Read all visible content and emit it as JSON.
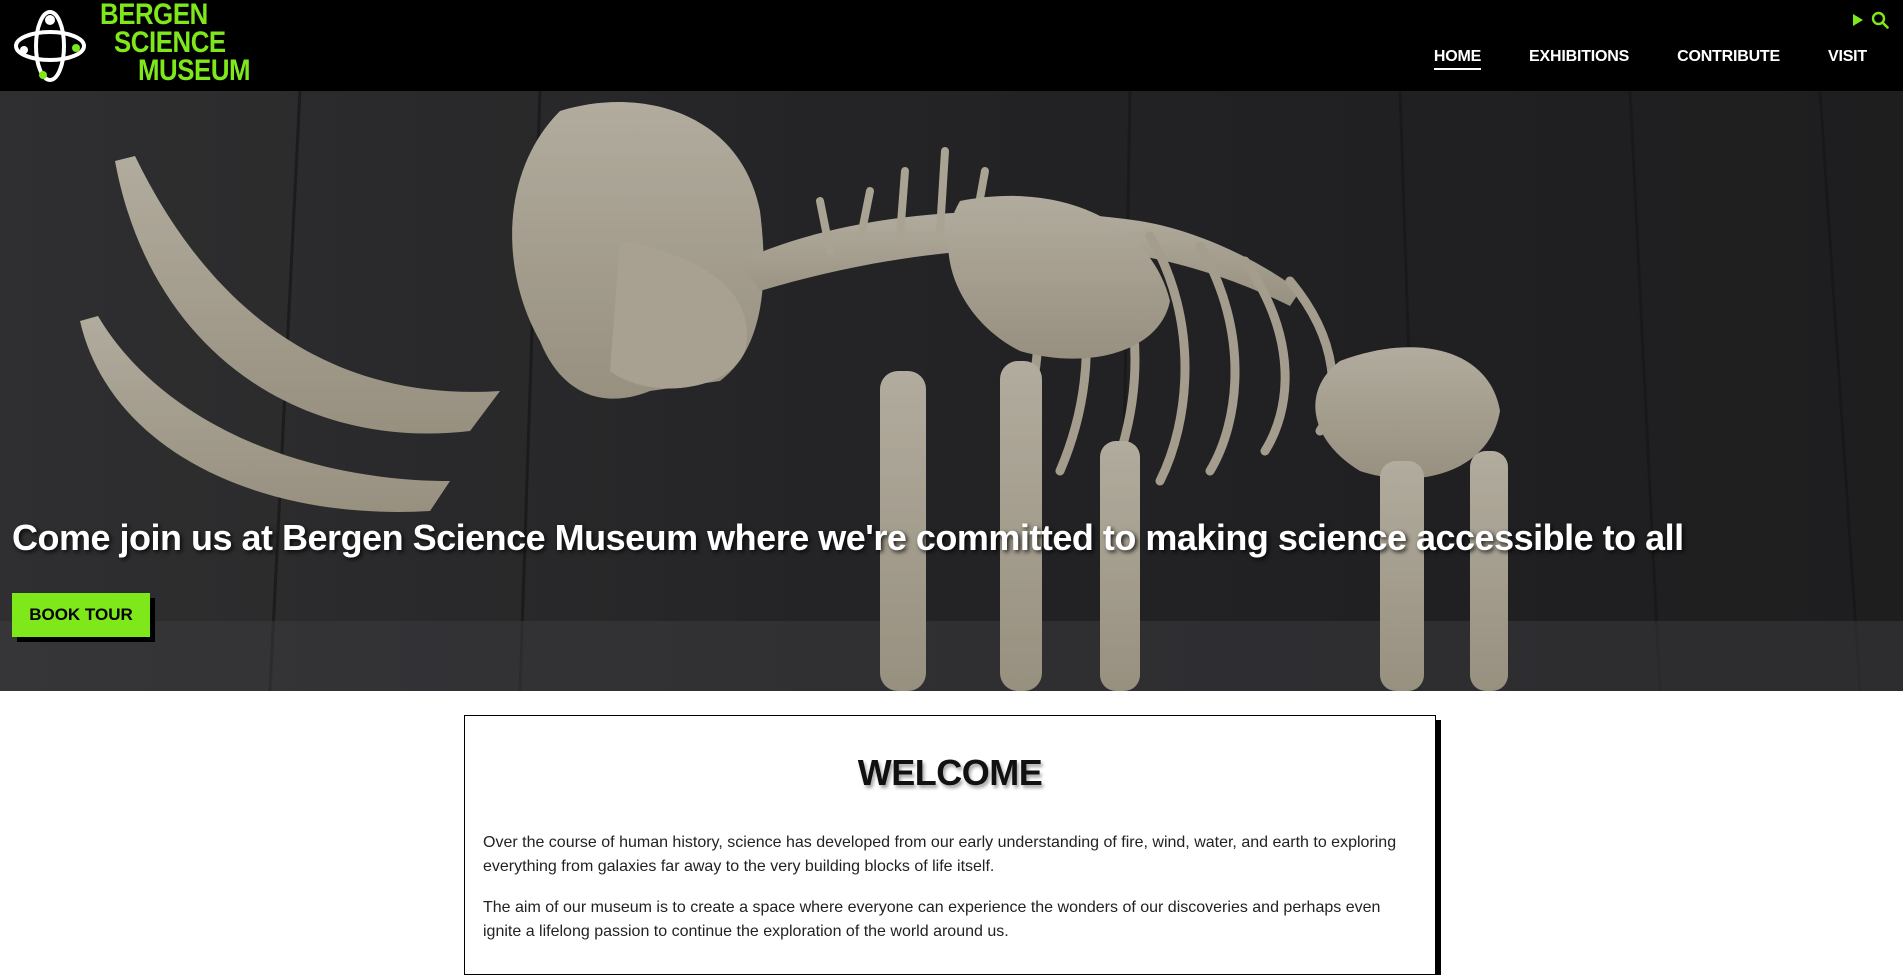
{
  "header": {
    "logo_line1": "BERGEN",
    "logo_line2": "SCIENCE",
    "logo_line3": "MUSEUM",
    "nav": [
      "HOME",
      "EXHIBITIONS",
      "CONTRIBUTE",
      "VISIT"
    ],
    "active_nav": "HOME",
    "icons": [
      "play-icon",
      "search-icon"
    ]
  },
  "hero": {
    "headline": "Come join us at Bergen Science Museum where we're committed to making science accessible to all",
    "cta_label": "BOOK TOUR"
  },
  "welcome": {
    "title": "WELCOME",
    "paragraphs": [
      "Over the course of human history, science has developed from our early understanding of fire, wind, water, and earth to exploring everything from galaxies far away to the very building blocks of life itself.",
      "The aim of our museum is to create a space where everyone can experience the wonders of our discoveries and perhaps even ignite a lifelong passion to continue the exploration of the world around us."
    ]
  },
  "colors": {
    "accent": "#7fe81b",
    "header_bg": "#000000",
    "text_light": "#ffffff"
  }
}
